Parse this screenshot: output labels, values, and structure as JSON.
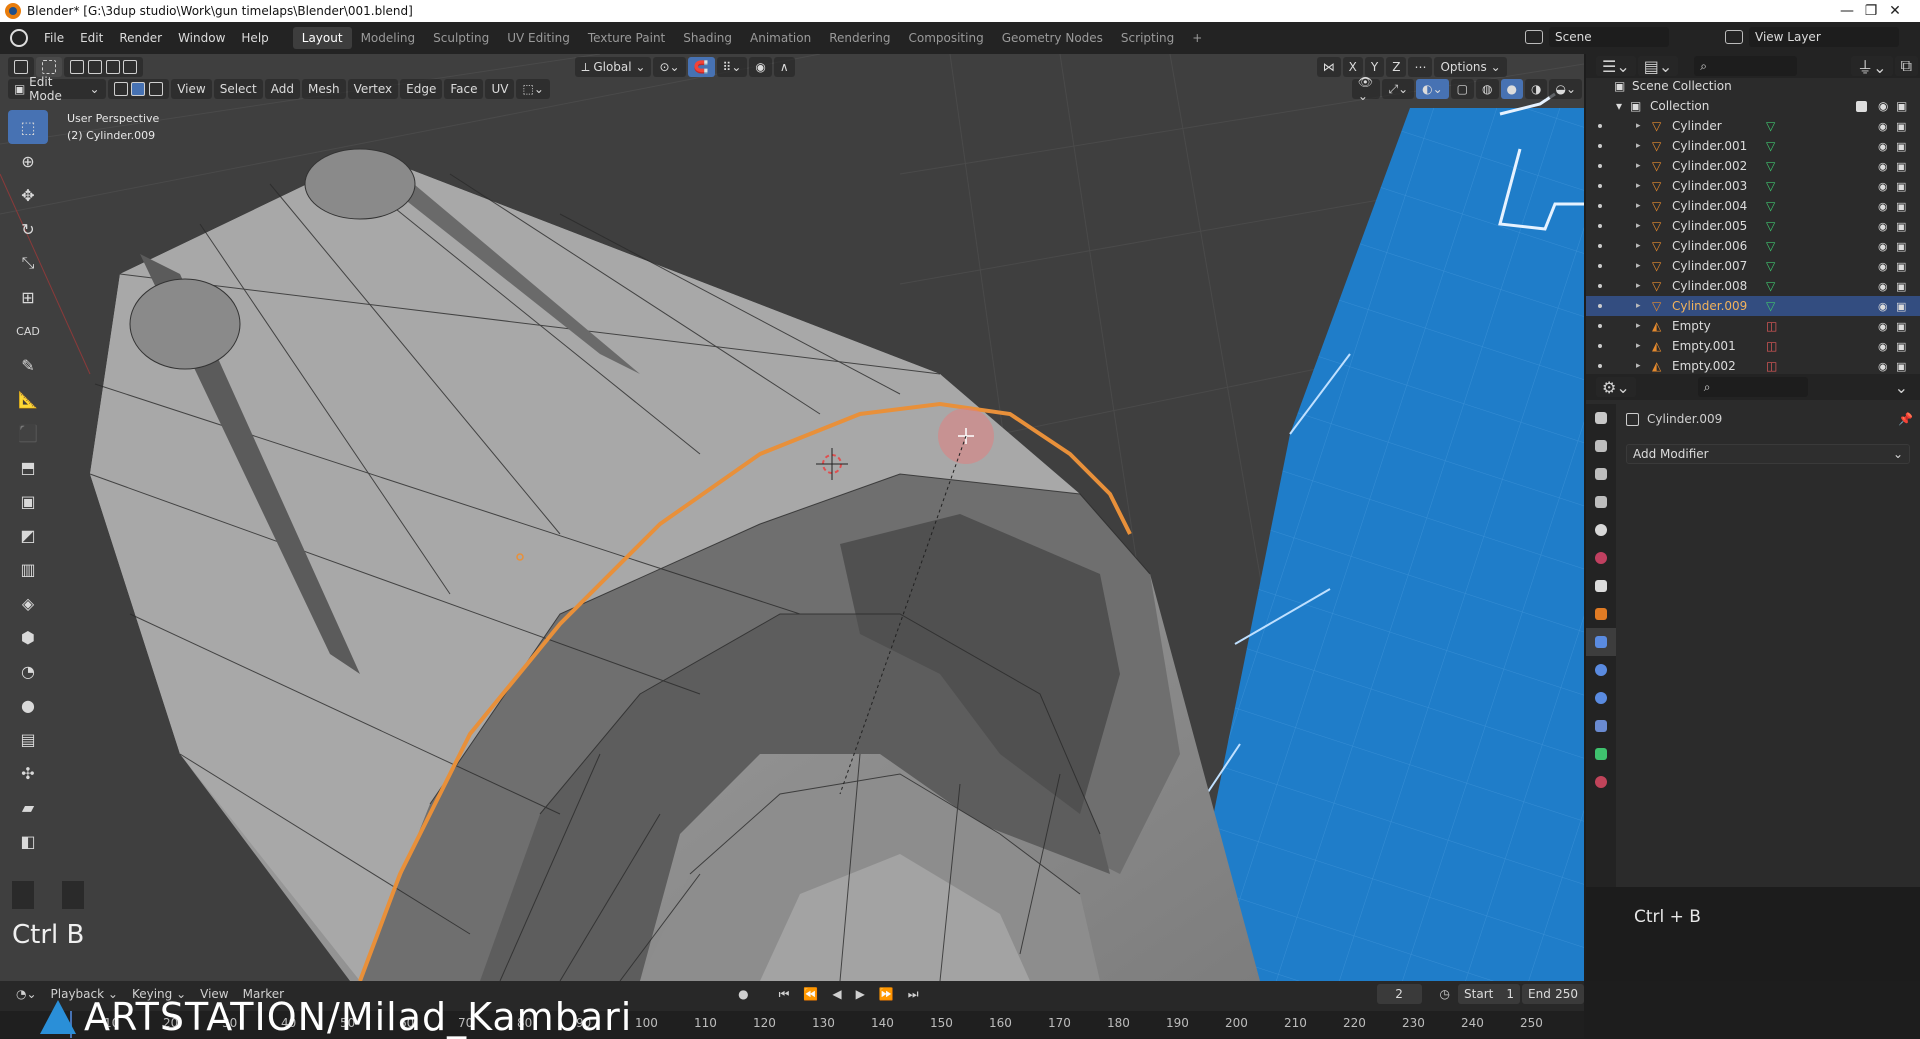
{
  "window": {
    "title": "Blender* [G:\\3dup studio\\Work\\gun timelaps\\Blender\\001.blend]",
    "controls": [
      "—",
      "❐",
      "✕"
    ]
  },
  "menubar": {
    "menus": [
      "File",
      "Edit",
      "Render",
      "Window",
      "Help"
    ],
    "workspaces": [
      "Layout",
      "Modeling",
      "Sculpting",
      "UV Editing",
      "Texture Paint",
      "Shading",
      "Animation",
      "Rendering",
      "Compositing",
      "Geometry Nodes",
      "Scripting"
    ],
    "active_workspace": "Layout",
    "add_tab": "+",
    "scene": "Scene",
    "view_layer": "View Layer"
  },
  "viewport": {
    "transform_orientation": "Global",
    "options_label": "Options",
    "axes": [
      "X",
      "Y",
      "Z"
    ],
    "mode": "Edit Mode",
    "header_menus": [
      "View",
      "Select",
      "Add",
      "Mesh",
      "Vertex",
      "Edge",
      "Face",
      "UV"
    ],
    "overlay_text_line1": "User Perspective",
    "overlay_text_line2": "(2) Cylinder.009",
    "key_hint": "Ctrl B",
    "cad_label": "CAD"
  },
  "outliner": {
    "root": "Scene Collection",
    "collection": "Collection",
    "items": [
      {
        "name": "Cylinder",
        "type": "mesh"
      },
      {
        "name": "Cylinder.001",
        "type": "mesh"
      },
      {
        "name": "Cylinder.002",
        "type": "mesh"
      },
      {
        "name": "Cylinder.003",
        "type": "mesh"
      },
      {
        "name": "Cylinder.004",
        "type": "mesh"
      },
      {
        "name": "Cylinder.005",
        "type": "mesh"
      },
      {
        "name": "Cylinder.006",
        "type": "mesh"
      },
      {
        "name": "Cylinder.007",
        "type": "mesh"
      },
      {
        "name": "Cylinder.008",
        "type": "mesh"
      },
      {
        "name": "Cylinder.009",
        "type": "mesh",
        "selected": true
      },
      {
        "name": "Empty",
        "type": "empty"
      },
      {
        "name": "Empty.001",
        "type": "empty"
      },
      {
        "name": "Empty.002",
        "type": "empty"
      }
    ]
  },
  "properties": {
    "object_name": "Cylinder.009",
    "add_modifier_label": "Add Modifier"
  },
  "key_overlay": "Ctrl + B",
  "timeline": {
    "menus": [
      "Playback",
      "Keying",
      "View",
      "Marker"
    ],
    "current_frame": "2",
    "start_label": "Start",
    "start_value": "1",
    "end_label": "End",
    "end_value": "250",
    "ruler": [
      "10",
      "20",
      "30",
      "40",
      "50",
      "60",
      "70",
      "80",
      "90",
      "100",
      "110",
      "120",
      "130",
      "140",
      "150",
      "160",
      "170",
      "180",
      "190",
      "200",
      "210",
      "220",
      "230",
      "240",
      "250"
    ]
  },
  "watermark": "ARTSTATION/Milad_Kambari",
  "colors": {
    "accent_blue": "#4772b3",
    "selection_orange": "#e8903a",
    "blueprint": "#1f7dc9",
    "mesh_grey": "#9a9a9a"
  }
}
